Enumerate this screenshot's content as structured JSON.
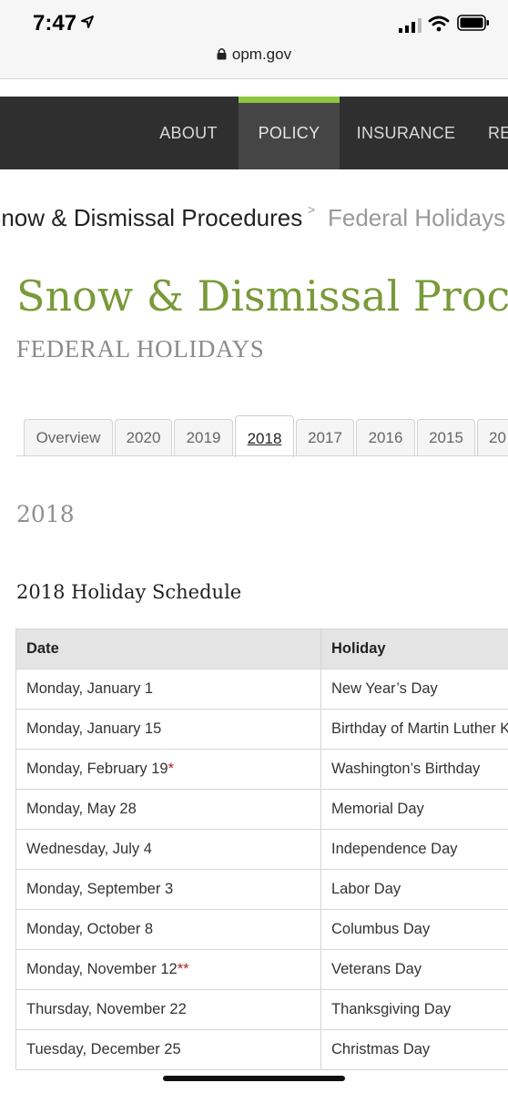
{
  "status": {
    "time": "7:47",
    "url": "opm.gov"
  },
  "nav": {
    "items": [
      "ABOUT",
      "POLICY",
      "INSURANCE",
      "RE"
    ],
    "active_index": 1,
    "accent": "#8dc63f"
  },
  "breadcrumb": {
    "parent": "Snow & Dismissal Procedures",
    "separator": ">",
    "current": "Federal Holidays"
  },
  "page": {
    "title": "Snow & Dismissal Procedures",
    "subtitle": "FEDERAL HOLIDAYS",
    "year_heading": "2018",
    "schedule_title": "2018 Holiday Schedule",
    "title_color": "#7a9a3a"
  },
  "tabs": {
    "items": [
      "Overview",
      "2020",
      "2019",
      "2018",
      "2017",
      "2016",
      "2015",
      "20"
    ],
    "active_index": 3
  },
  "table": {
    "headers": [
      "Date",
      "Holiday"
    ],
    "rows": [
      {
        "date": "Monday, January 1",
        "mark": "",
        "holiday": "New Year’s Day"
      },
      {
        "date": "Monday, January 15",
        "mark": "",
        "holiday": "Birthday of Martin Luther K"
      },
      {
        "date": "Monday, February 19",
        "mark": "*",
        "holiday": "Washington’s Birthday"
      },
      {
        "date": "Monday, May 28",
        "mark": "",
        "holiday": "Memorial Day"
      },
      {
        "date": "Wednesday, July 4",
        "mark": "",
        "holiday": "Independence Day"
      },
      {
        "date": "Monday, September 3",
        "mark": "",
        "holiday": "Labor Day"
      },
      {
        "date": "Monday, October 8",
        "mark": "",
        "holiday": "Columbus Day"
      },
      {
        "date": "Monday, November 12",
        "mark": "**",
        "holiday": "Veterans Day"
      },
      {
        "date": "Thursday, November 22",
        "mark": "",
        "holiday": "Thanksgiving Day"
      },
      {
        "date": "Tuesday, December 25",
        "mark": "",
        "holiday": "Christmas Day"
      }
    ]
  }
}
